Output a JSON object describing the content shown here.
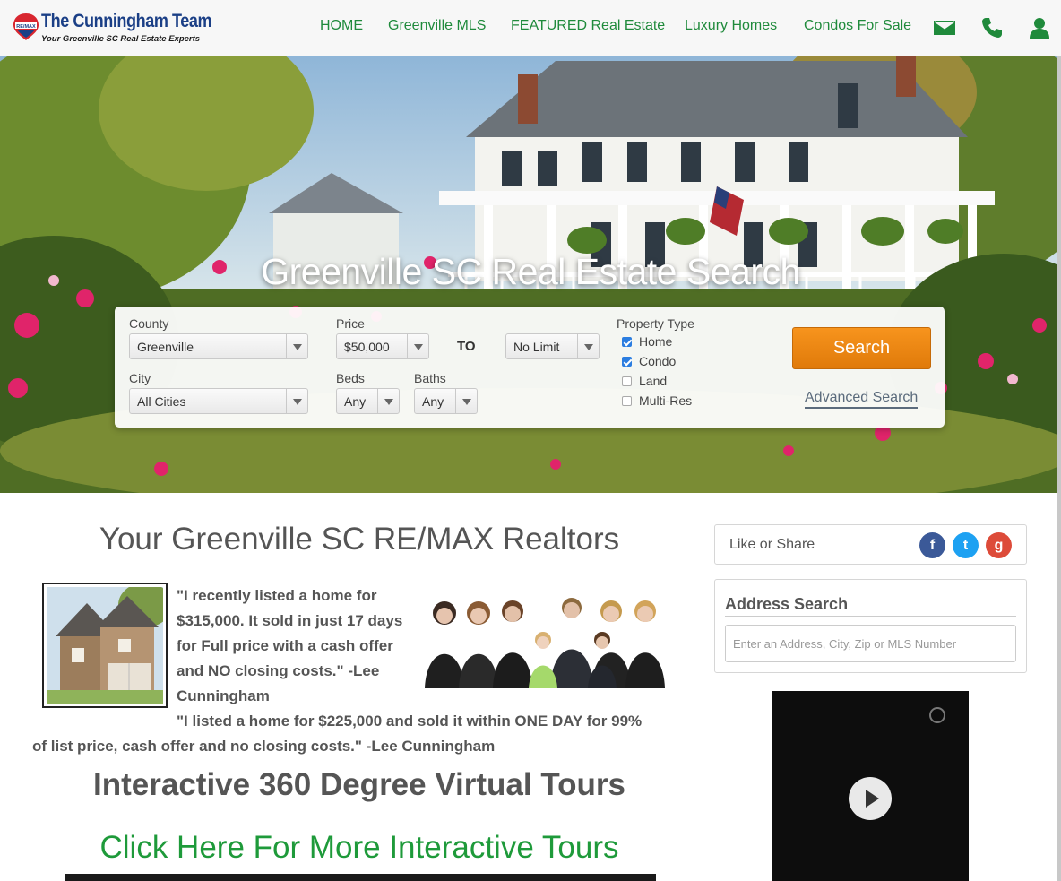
{
  "header": {
    "logo_title": "The Cunningham Team",
    "logo_tagline": "Your Greenville SC Real Estate Experts",
    "logo_badge": "RE/MAX",
    "nav": [
      "HOME",
      "Greenville MLS",
      "FEATURED Real Estate",
      "Luxury Homes",
      "Condos For Sale"
    ],
    "icons": [
      "envelope-icon",
      "phone-icon",
      "user-icon"
    ]
  },
  "hero": {
    "title": "Greenville SC Real Estate Search"
  },
  "search_form": {
    "county_label": "County",
    "county_value": "Greenville",
    "price_label": "Price",
    "price_min": "$50,000",
    "to_label": "TO",
    "price_max": "No Limit",
    "city_label": "City",
    "city_value": "All Cities",
    "beds_label": "Beds",
    "beds_value": "Any",
    "baths_label": "Baths",
    "baths_value": "Any",
    "property_type_label": "Property Type",
    "property_types": [
      {
        "label": "Home",
        "checked": true
      },
      {
        "label": "Condo",
        "checked": true
      },
      {
        "label": "Land",
        "checked": false
      },
      {
        "label": "Multi-Res",
        "checked": false
      }
    ],
    "search_button": "Search",
    "advanced_link": "Advanced Search"
  },
  "main": {
    "heading": "Your Greenville SC RE/MAX Realtors",
    "quote1": "\"I recently listed a home for $315,000. It sold in just 17 days for Full price with a cash offer and NO closing costs.\" -Lee Cunningham",
    "quote2_line1": "\"I listed a home for $225,000 and sold it within ONE DAY for 99%",
    "quote2_line2": "of list price, cash offer and no closing costs.\" -Lee Cunningham",
    "tours_heading": "Interactive 360 Degree Virtual Tours",
    "tours_link": "Click Here For More Interactive Tours"
  },
  "sidebar": {
    "share_label": "Like or Share",
    "social": [
      {
        "name": "facebook-icon",
        "glyph": "f",
        "color": "#3b5998"
      },
      {
        "name": "twitter-icon",
        "glyph": "t",
        "color": "#1da1f2"
      },
      {
        "name": "google-plus-icon",
        "glyph": "g",
        "color": "#dd4b39"
      }
    ],
    "address_title": "Address Search",
    "address_placeholder": "Enter an Address, City, Zip or MLS Number"
  },
  "colors": {
    "brand_green": "#1f8a3b",
    "link_green": "#1e9a3a",
    "search_orange": "#f7941d",
    "logo_blue": "#1b3f86"
  }
}
